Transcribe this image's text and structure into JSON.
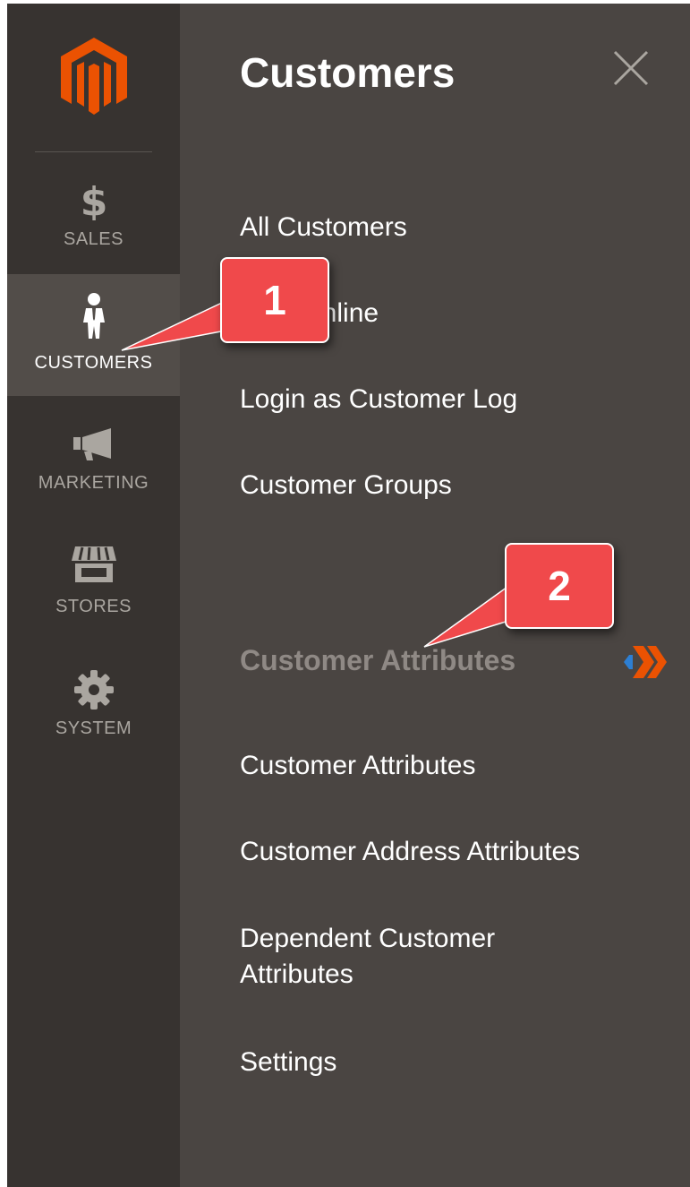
{
  "sidebar": {
    "items": [
      {
        "label": "SALES",
        "icon": "dollar-icon"
      },
      {
        "label": "CUSTOMERS",
        "icon": "customer-icon",
        "active": true
      },
      {
        "label": "MARKETING",
        "icon": "megaphone-icon"
      },
      {
        "label": "STORES",
        "icon": "storefront-icon"
      },
      {
        "label": "SYSTEM",
        "icon": "gear-icon"
      }
    ]
  },
  "submenu": {
    "title": "Customers",
    "links": [
      {
        "label": "All Customers"
      },
      {
        "label": "Now Online"
      },
      {
        "label": "Login as Customer Log"
      },
      {
        "label": "Customer Groups"
      }
    ],
    "group": {
      "title": "Customer Attributes",
      "links": [
        {
          "label": "Customer Attributes"
        },
        {
          "label": "Customer Address Attributes"
        },
        {
          "label": "Dependent Customer Attributes"
        },
        {
          "label": "Settings"
        }
      ]
    }
  },
  "callouts": [
    {
      "number": "1"
    },
    {
      "number": "2"
    }
  ],
  "colors": {
    "rail_bg": "#373330",
    "panel_bg": "#4a4542",
    "active_bg": "#524d49",
    "brand_orange": "#eb5202",
    "callout_red": "#f0494b"
  }
}
